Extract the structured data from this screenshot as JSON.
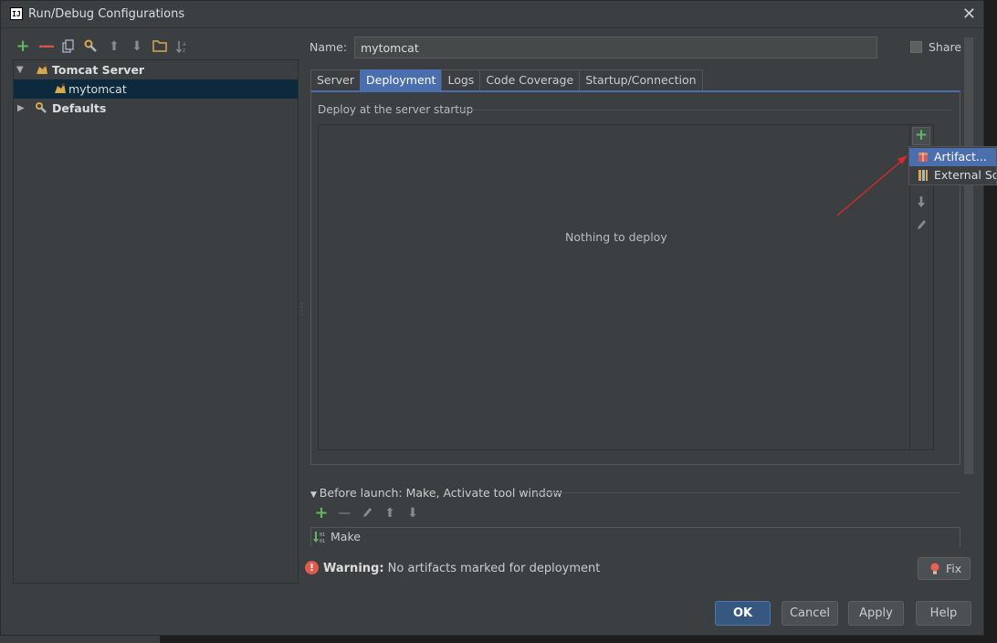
{
  "window": {
    "title": "Run/Debug Configurations",
    "app_icon_text": "IJ",
    "close_glyph": "✕"
  },
  "toolbar": {
    "add": "+",
    "remove": "—",
    "up": "⬆",
    "down": "⬇"
  },
  "tree": {
    "items": [
      {
        "label": "Tomcat Server"
      },
      {
        "label": "mytomcat"
      },
      {
        "label": "Defaults"
      }
    ]
  },
  "form": {
    "name_label": "Name:",
    "name_value": "mytomcat",
    "share_label": "Share"
  },
  "tabs": [
    "Server",
    "Deployment",
    "Logs",
    "Code Coverage",
    "Startup/Connection"
  ],
  "deployment": {
    "section_title": "Deploy at the server startup",
    "empty_text": "Nothing to deploy",
    "add_glyph": "+"
  },
  "popup": {
    "items": [
      "Artifact...",
      "External Source..."
    ]
  },
  "before_launch": {
    "title": "Before launch: Make, Activate tool window",
    "task": "Make"
  },
  "warning": {
    "label": "Warning:",
    "message": " No artifacts marked for deployment",
    "fix_label": "Fix"
  },
  "buttons": {
    "ok": "OK",
    "cancel": "Cancel",
    "apply": "Apply",
    "help": "Help"
  }
}
